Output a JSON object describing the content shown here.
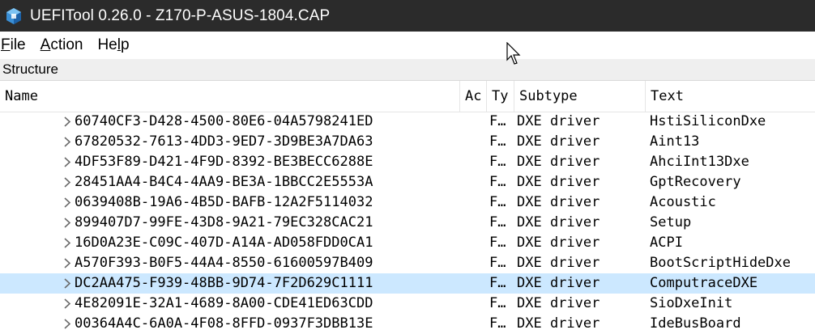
{
  "window": {
    "title": "UEFITool 0.26.0 - Z170-P-ASUS-1804.CAP",
    "icon": "uefitool-icon"
  },
  "menu": {
    "items": [
      {
        "label_rest": "ile",
        "mnemonic": "F"
      },
      {
        "label_rest": "ction",
        "mnemonic": "A"
      },
      {
        "label_prefix": "He",
        "mnemonic": "l",
        "label_rest": "p"
      }
    ]
  },
  "structure": {
    "label": "Structure"
  },
  "columns": {
    "name": "Name",
    "action": "Ac",
    "type": "Ty",
    "subtype": "Subtype",
    "text": "Text"
  },
  "rows": [
    {
      "name": "60740CF3-D428-4500-80E6-04A5798241ED",
      "type": "F…",
      "subtype": "DXE driver",
      "text": "HstiSiliconDxe"
    },
    {
      "name": "67820532-7613-4DD3-9ED7-3D9BE3A7DA63",
      "type": "F…",
      "subtype": "DXE driver",
      "text": "Aint13"
    },
    {
      "name": "4DF53F89-D421-4F9D-8392-BE3BECC6288E",
      "type": "F…",
      "subtype": "DXE driver",
      "text": "AhciInt13Dxe"
    },
    {
      "name": "28451AA4-B4C4-4AA9-BE3A-1BBCC2E5553A",
      "type": "F…",
      "subtype": "DXE driver",
      "text": "GptRecovery"
    },
    {
      "name": "0639408B-19A6-4B5D-BAFB-12A2F5114032",
      "type": "F…",
      "subtype": "DXE driver",
      "text": "Acoustic"
    },
    {
      "name": "899407D7-99FE-43D8-9A21-79EC328CAC21",
      "type": "F…",
      "subtype": "DXE driver",
      "text": "Setup"
    },
    {
      "name": "16D0A23E-C09C-407D-A14A-AD058FDD0CA1",
      "type": "F…",
      "subtype": "DXE driver",
      "text": "ACPI"
    },
    {
      "name": "A570F393-B0F5-44A4-8550-61600597B409",
      "type": "F…",
      "subtype": "DXE driver",
      "text": "BootScriptHideDxe"
    },
    {
      "name": "DC2AA475-F939-48BB-9D74-7F2D629C1111",
      "type": "F…",
      "subtype": "DXE driver",
      "text": "ComputraceDXE",
      "selected": true
    },
    {
      "name": "4E82091E-32A1-4689-8A00-CDE41ED63CDD",
      "type": "F…",
      "subtype": "DXE driver",
      "text": "SioDxeInit"
    },
    {
      "name": "00364A4C-6A0A-4F08-8FFD-0937F3DBB13E",
      "type": "F…",
      "subtype": "DXE driver",
      "text": "IdeBusBoard"
    }
  ],
  "colors": {
    "titlebar": "#2b2b2b",
    "selection": "#cce8ff",
    "structure_bar": "#efefef"
  }
}
